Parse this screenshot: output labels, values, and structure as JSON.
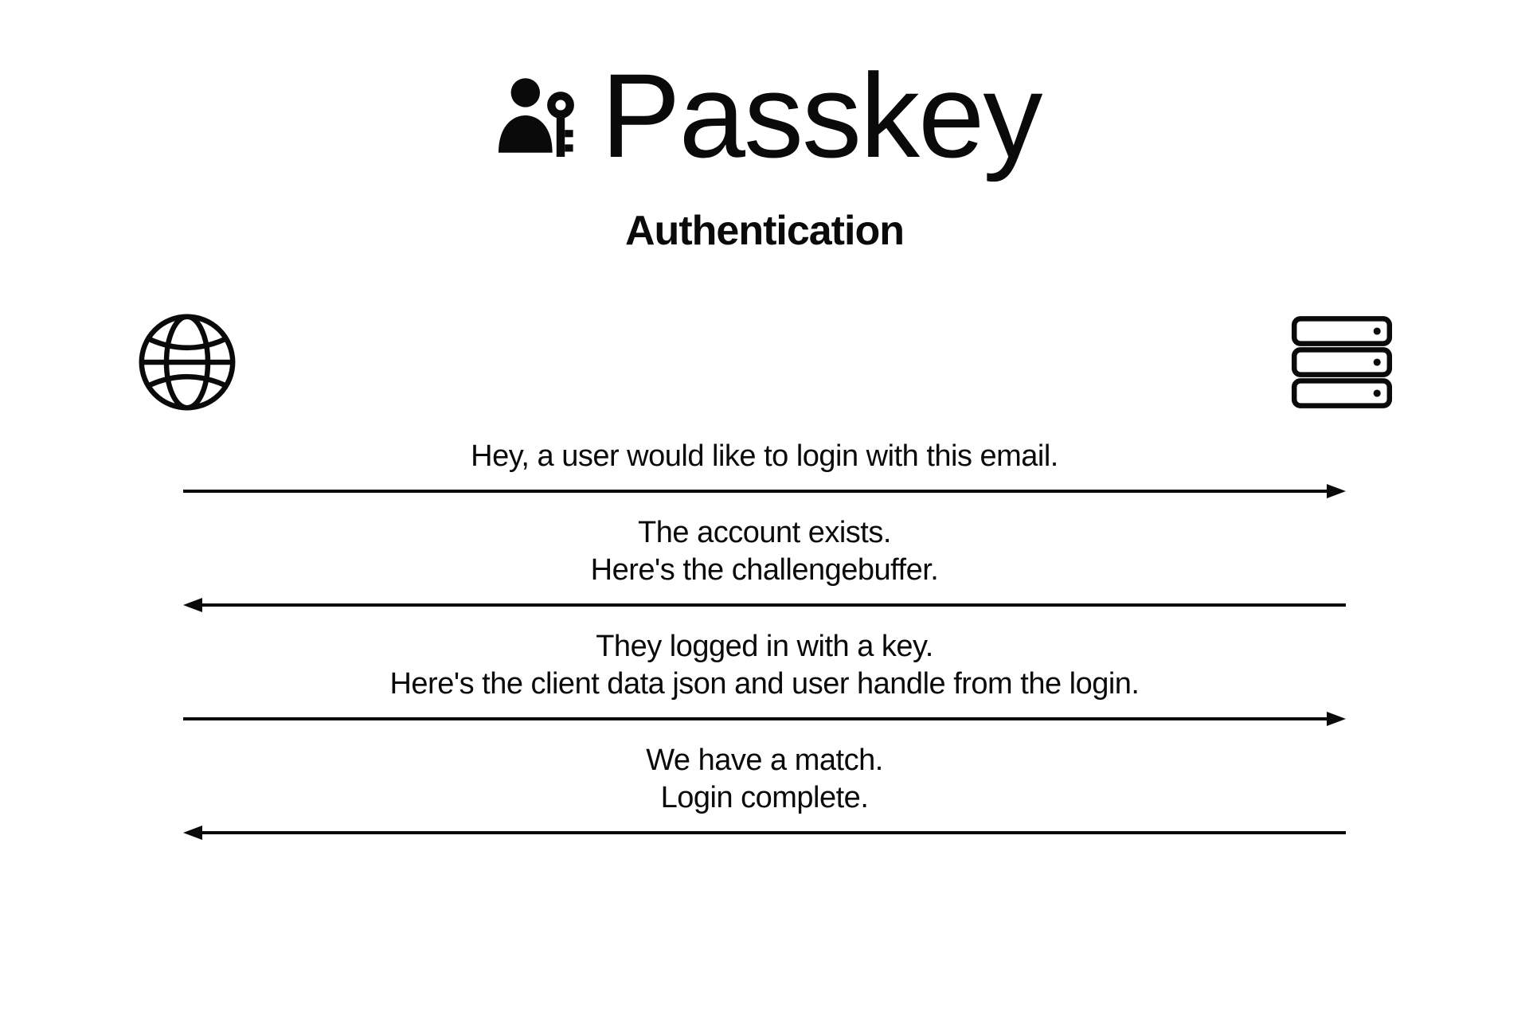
{
  "header": {
    "title": "Passkey",
    "subtitle": "Authentication"
  },
  "actors": {
    "left": "browser-client",
    "right": "server"
  },
  "steps": [
    {
      "direction": "right",
      "lines": [
        "Hey, a user would like to login with this email."
      ]
    },
    {
      "direction": "left",
      "lines": [
        "The account exists.",
        "Here's the challengebuffer."
      ]
    },
    {
      "direction": "right",
      "lines": [
        "They logged in with a key.",
        "Here's the client data json and user handle from the login."
      ]
    },
    {
      "direction": "left",
      "lines": [
        "We have a match.",
        "Login complete."
      ]
    }
  ]
}
